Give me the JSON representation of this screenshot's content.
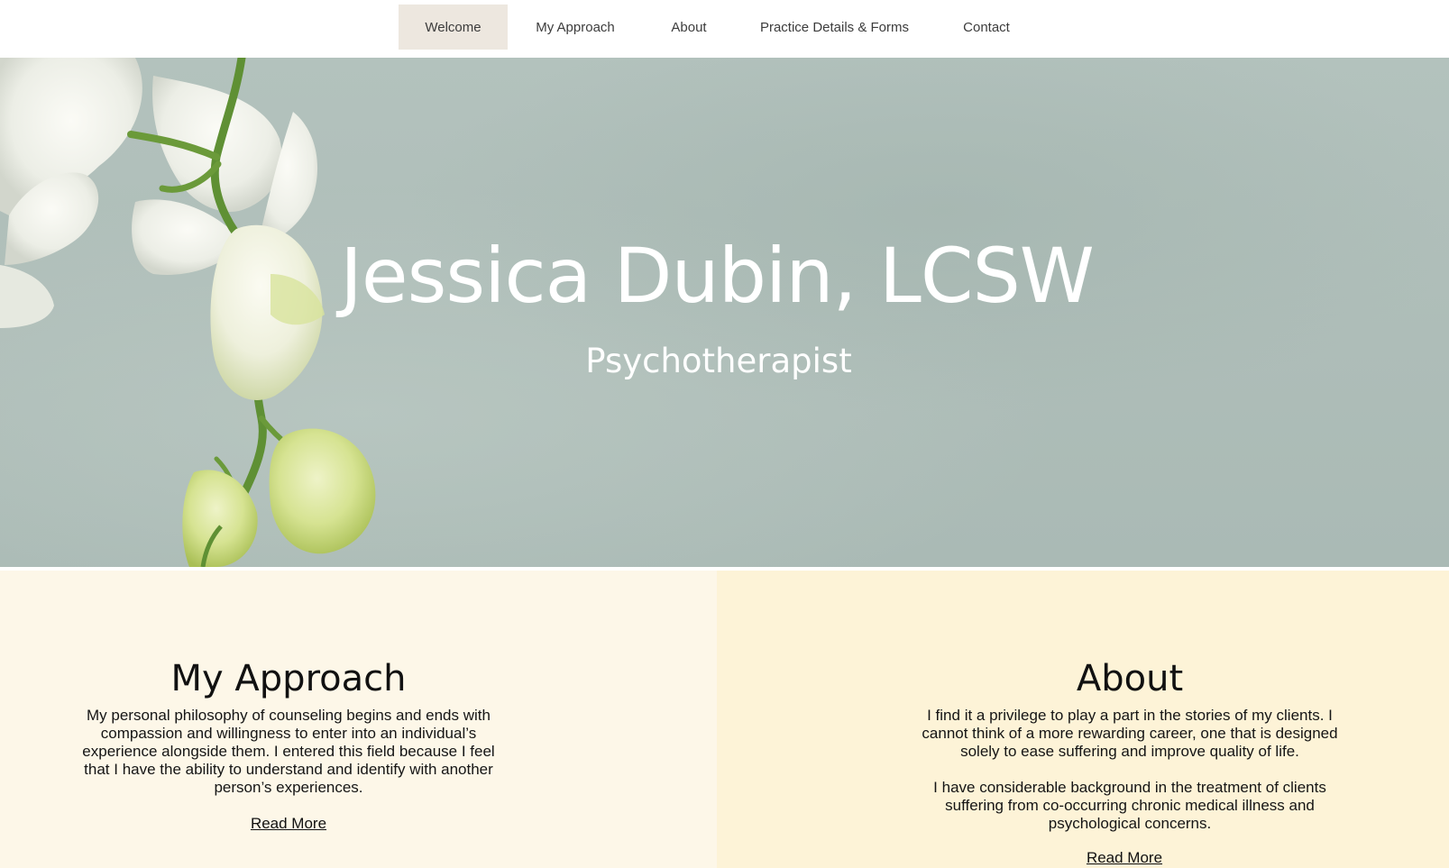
{
  "nav": {
    "items": [
      {
        "label": "Welcome",
        "active": true
      },
      {
        "label": "My Approach",
        "active": false
      },
      {
        "label": "About",
        "active": false
      },
      {
        "label": "Practice Details & Forms",
        "active": false
      },
      {
        "label": "Contact",
        "active": false
      }
    ]
  },
  "hero": {
    "title": "Jessica Dubin, LCSW",
    "subtitle": "Psychotherapist",
    "image_icon": "white-orchid-stem"
  },
  "approach": {
    "heading": "My Approach",
    "body": "My personal philosophy of counseling begins and ends with compassion and willingness to enter into an individual’s experience alongside them. I entered this field because I feel that I have the ability to understand and identify with another person’s experiences.",
    "link": "Read More"
  },
  "about": {
    "heading": "About",
    "body1": "I find it a privilege to play a part in the stories of my clients. I cannot think of a more rewarding career, one that is designed solely to ease suffering and improve quality of life.",
    "body2": "I have considerable background in the treatment of clients suffering from co-occurring chronic medical illness and psychological concerns.",
    "link": "Read More"
  },
  "colors": {
    "nav_active_bg": "#ede7df",
    "hero_bg": "#afbeb9",
    "left_panel_bg": "#fdf7e8",
    "right_panel_bg": "#fdf3d7"
  }
}
